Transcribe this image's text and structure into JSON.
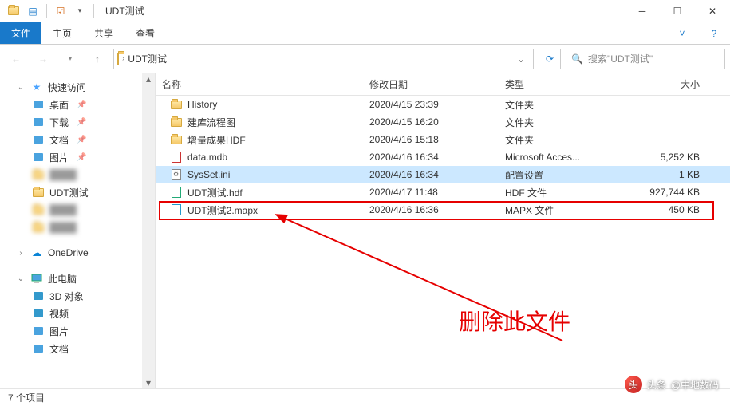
{
  "window": {
    "title": "UDT测试"
  },
  "ribbon": {
    "file": "文件",
    "tabs": [
      "主页",
      "共享",
      "查看"
    ]
  },
  "address": {
    "crumbs": [
      "UDT测试"
    ],
    "search_placeholder": "搜索\"UDT测试\""
  },
  "nav": {
    "quick_access": "快速访问",
    "items": [
      {
        "label": "桌面",
        "pinned": true,
        "icon": "desktop"
      },
      {
        "label": "下载",
        "pinned": true,
        "icon": "download"
      },
      {
        "label": "文档",
        "pinned": true,
        "icon": "document"
      },
      {
        "label": "图片",
        "pinned": true,
        "icon": "picture"
      },
      {
        "label": "",
        "pinned": false,
        "blur": true
      },
      {
        "label": "UDT测试",
        "pinned": false,
        "icon": "folder"
      },
      {
        "label": "",
        "pinned": false,
        "blur": true
      },
      {
        "label": "",
        "pinned": false,
        "blur": true
      }
    ],
    "onedrive": "OneDrive",
    "thispc": "此电脑",
    "pc_items": [
      {
        "label": "3D 对象",
        "icon": "3d"
      },
      {
        "label": "视频",
        "icon": "video"
      },
      {
        "label": "图片",
        "icon": "picture"
      },
      {
        "label": "文档",
        "icon": "document"
      }
    ]
  },
  "columns": {
    "name": "名称",
    "date": "修改日期",
    "type": "类型",
    "size": "大小"
  },
  "rows": [
    {
      "name": "History",
      "date": "2020/4/15 23:39",
      "type": "文件夹",
      "size": "",
      "kind": "folder"
    },
    {
      "name": "建库流程图",
      "date": "2020/4/15 16:20",
      "type": "文件夹",
      "size": "",
      "kind": "folder"
    },
    {
      "name": "增量成果HDF",
      "date": "2020/4/16 15:18",
      "type": "文件夹",
      "size": "",
      "kind": "folder"
    },
    {
      "name": "data.mdb",
      "date": "2020/4/16 16:34",
      "type": "Microsoft Acces...",
      "size": "5,252 KB",
      "kind": "mdb"
    },
    {
      "name": "SysSet.ini",
      "date": "2020/4/16 16:34",
      "type": "配置设置",
      "size": "1 KB",
      "kind": "ini",
      "selected": true
    },
    {
      "name": "UDT测试.hdf",
      "date": "2020/4/17 11:48",
      "type": "HDF 文件",
      "size": "927,744 KB",
      "kind": "hdf"
    },
    {
      "name": "UDT测试2.mapx",
      "date": "2020/4/16 16:36",
      "type": "MAPX 文件",
      "size": "450 KB",
      "kind": "mapx"
    }
  ],
  "status": {
    "count": "7 个项目"
  },
  "annotation": {
    "text": "删除此文件"
  },
  "watermark": {
    "prefix": "头条",
    "author": "@中地数码"
  }
}
